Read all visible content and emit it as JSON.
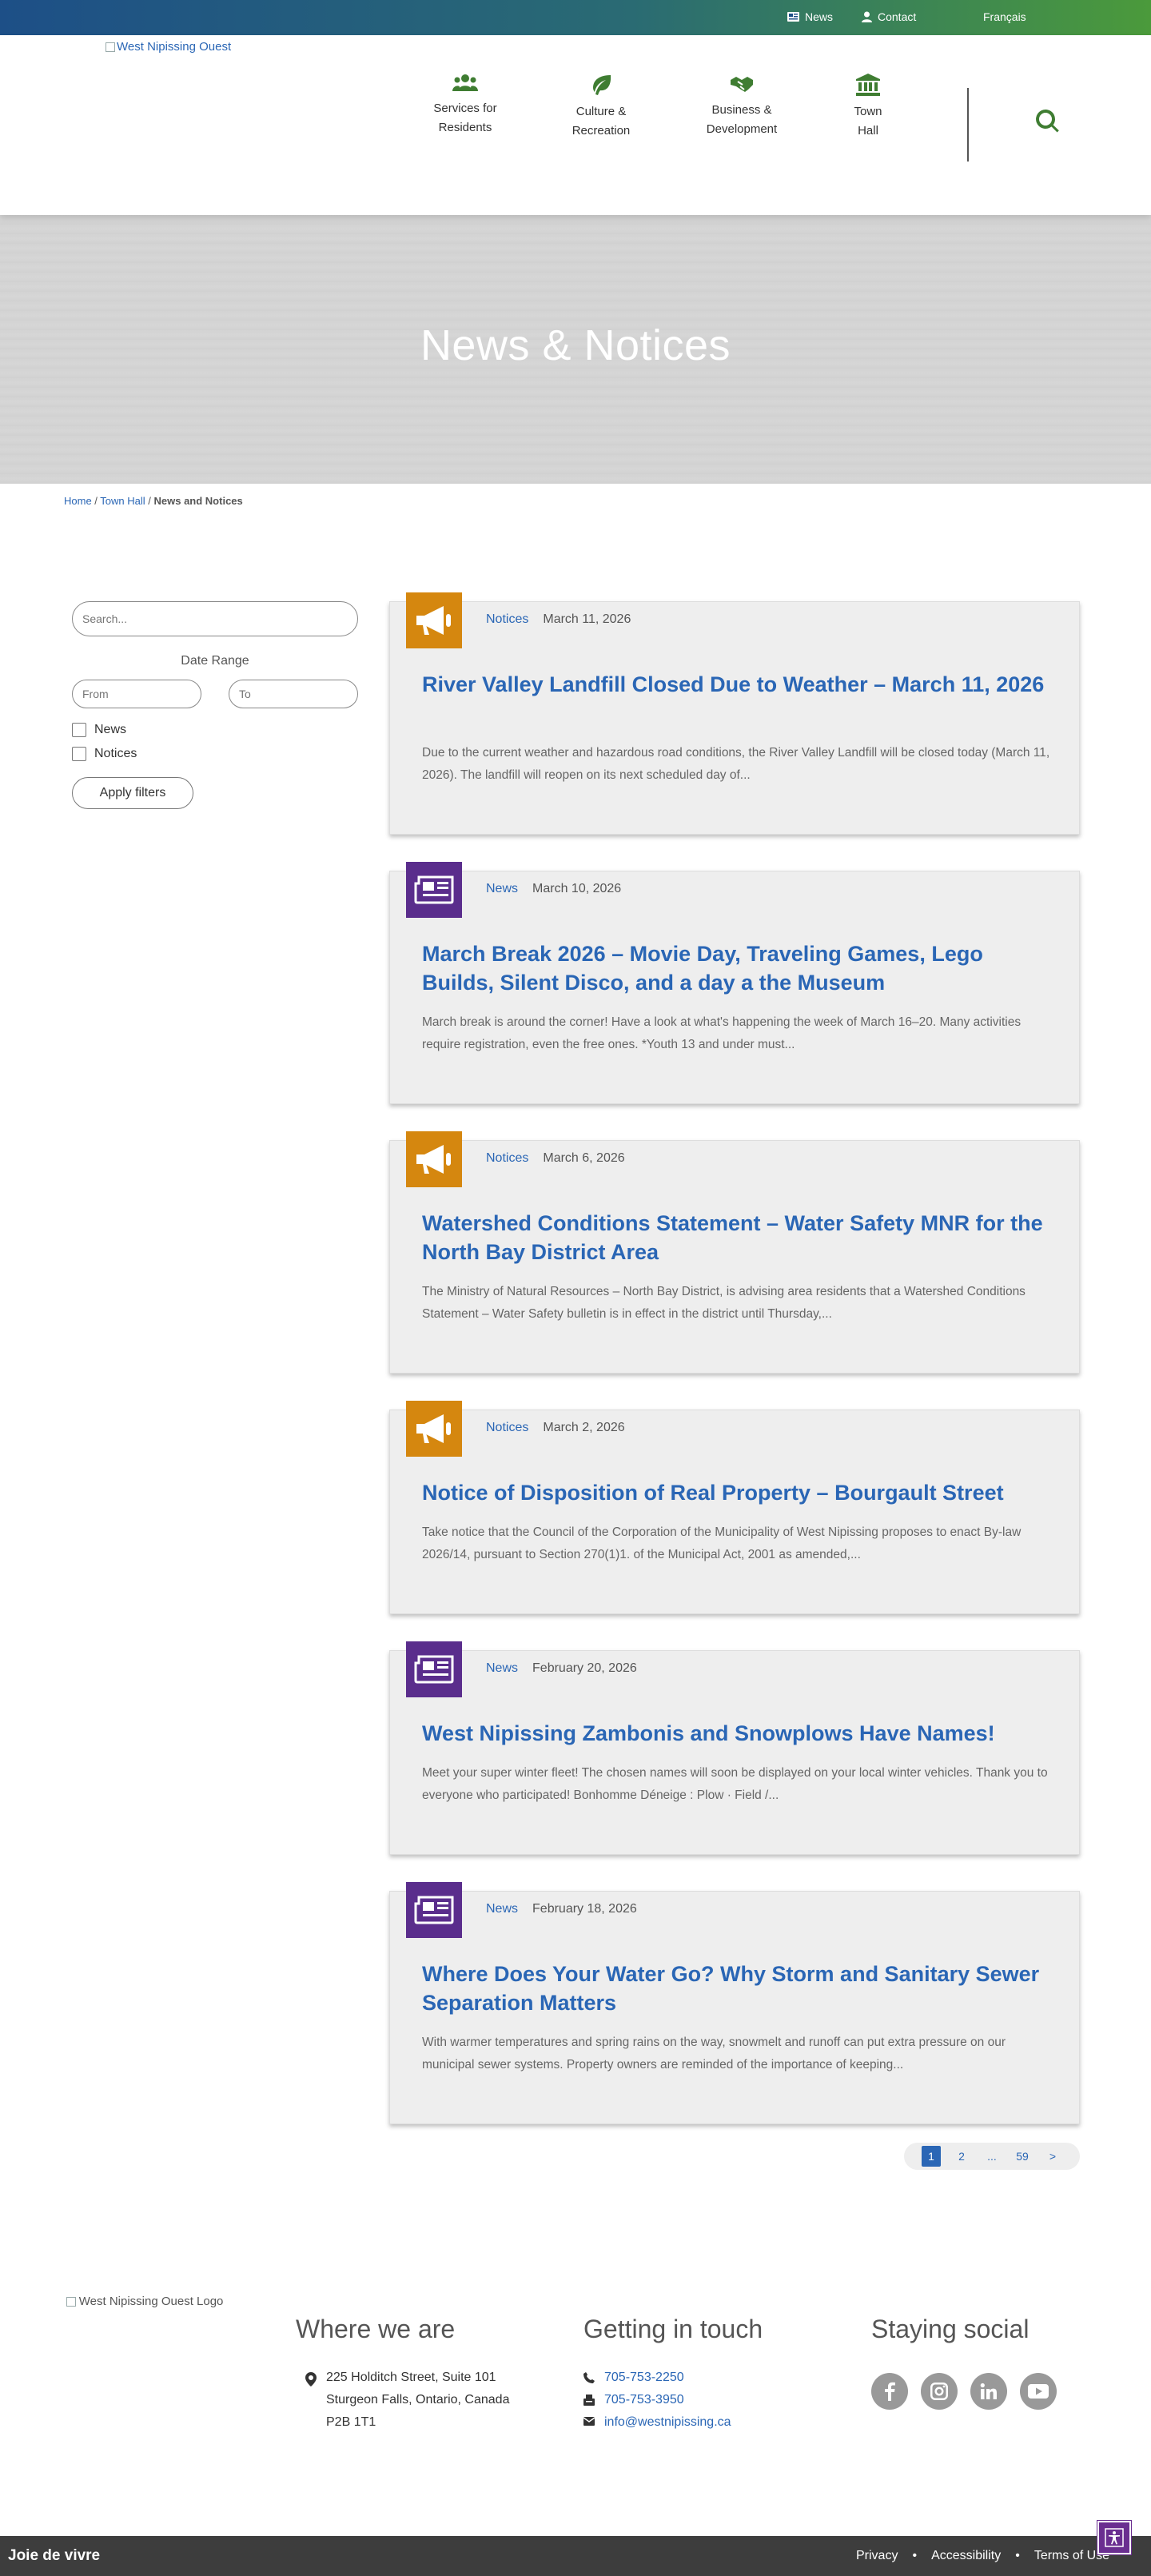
{
  "topbar": {
    "news_label": "News",
    "contact_label": "Contact",
    "language_label": "Français"
  },
  "header": {
    "logo_alt": "West Nipissing Ouest",
    "nav": [
      {
        "label_line1": "Services for",
        "label_line2": "Residents",
        "icon": "people-icon"
      },
      {
        "label_line1": "Culture &",
        "label_line2": "Recreation",
        "icon": "leaf-icon"
      },
      {
        "label_line1": "Business &",
        "label_line2": "Development",
        "icon": "handshake-icon"
      },
      {
        "label_line1": "Town",
        "label_line2": "Hall",
        "icon": "town-hall-icon"
      }
    ]
  },
  "hero": {
    "title": "News & Notices"
  },
  "breadcrumb": {
    "home": "Home",
    "sep1": " / ",
    "town_hall": "Town Hall",
    "sep2": " / ",
    "current": "News and Notices"
  },
  "filters": {
    "search_placeholder": "Search...",
    "date_range_label": "Date Range",
    "from_placeholder": "From",
    "to_placeholder": "To",
    "options": [
      {
        "label": "News"
      },
      {
        "label": "Notices"
      }
    ],
    "apply_label": "Apply filters"
  },
  "articles": [
    {
      "category": "Notices",
      "date": "March 11, 2026",
      "title": "River Valley Landfill Closed Due to Weather – March 11, 2026",
      "excerpt": "Due to the current weather and hazardous road conditions, the River Valley Landfill will be closed today (March 11, 2026). The landfill will reopen on its next scheduled day of..."
    },
    {
      "category": "News",
      "date": "March 10, 2026",
      "title": "March Break 2026 – Movie Day, Traveling Games, Lego Builds, Silent Disco, and a day a the Museum",
      "excerpt": "March break is around the corner! Have a look at what's happening the week of March 16–20. Many activities require registration, even the free ones. *Youth 13 and under must..."
    },
    {
      "category": "Notices",
      "date": "March 6, 2026",
      "title": "Watershed Conditions Statement – Water Safety MNR for the North Bay District Area",
      "excerpt": "The Ministry of Natural Resources – North Bay District, is advising area residents that a Watershed Conditions Statement – Water Safety bulletin is in effect in the district until Thursday,..."
    },
    {
      "category": "Notices",
      "date": "March 2, 2026",
      "title": "Notice of Disposition of Real Property – Bourgault Street",
      "excerpt": "Take notice that the Council of the Corporation of the Municipality of West Nipissing proposes to enact By-law 2026/14, pursuant to Section 270(1)1. of the Municipal Act, 2001 as amended,..."
    },
    {
      "category": "News",
      "date": "February 20, 2026",
      "title": "West Nipissing Zambonis and Snowplows Have Names!",
      "excerpt": "Meet your super winter fleet! The chosen names will soon be displayed on your local winter vehicles. Thank you to everyone who participated! Bonhomme Déneige : Plow · Field /..."
    },
    {
      "category": "News",
      "date": "February 18, 2026",
      "title": "Where Does Your Water Go? Why Storm and Sanitary Sewer Separation Matters",
      "excerpt": "With warmer temperatures and spring rains on the way, snowmelt and runoff can put extra pressure on our municipal sewer systems. Property owners are reminded of the importance of keeping..."
    }
  ],
  "pagination": {
    "pages": [
      "1",
      "2",
      "...",
      "59"
    ],
    "next": ">"
  },
  "footer": {
    "logo_alt": "West Nipissing Ouest Logo",
    "where_title": "Where we are",
    "address_lines": [
      "225 Holditch Street, Suite 101",
      "Sturgeon Falls, Ontario, Canada",
      "P2B 1T1"
    ],
    "contact_title": "Getting in touch",
    "phone": "705-753-2250",
    "fax": "705-753-3950",
    "email": "info@westnipissing.ca",
    "social_title": "Staying social",
    "social": [
      "facebook-icon",
      "instagram-icon",
      "linkedin-icon",
      "youtube-icon"
    ]
  },
  "bottombar": {
    "brand": "Joie de vivre",
    "links": [
      "Privacy",
      "Accessibility",
      "Terms of Use"
    ],
    "separator": "•"
  },
  "colors": {
    "link": "#2a66b5",
    "green": "#3f7d32",
    "notices": "#d5870f",
    "news": "#5a2d8c"
  }
}
